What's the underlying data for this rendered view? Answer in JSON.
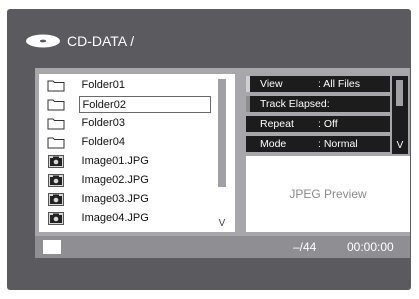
{
  "header": {
    "icon": "disc-icon",
    "path": "CD-DATA /"
  },
  "file_list": {
    "items": [
      {
        "label": "Folder01",
        "icon": "folder-icon",
        "selected": false
      },
      {
        "label": "Folder02",
        "icon": "folder-icon",
        "selected": true
      },
      {
        "label": "Folder03",
        "icon": "folder-icon",
        "selected": false
      },
      {
        "label": "Folder04",
        "icon": "folder-icon",
        "selected": false
      },
      {
        "label": "Image01.JPG",
        "icon": "camera-icon",
        "selected": false
      },
      {
        "label": "Image02.JPG",
        "icon": "camera-icon",
        "selected": false
      },
      {
        "label": "Image03.JPG",
        "icon": "camera-icon",
        "selected": false
      },
      {
        "label": "Image04.JPG",
        "icon": "camera-icon",
        "selected": false
      }
    ],
    "scroll_arrow": "V"
  },
  "info": {
    "rows": [
      {
        "key": "View",
        "value": ": All Files"
      },
      {
        "key": "Track Elapsed:",
        "value": ""
      },
      {
        "key": "Repeat",
        "value": ": Off"
      },
      {
        "key": "Mode",
        "value": ": Normal"
      }
    ],
    "scroll_arrow": "V"
  },
  "preview": {
    "label": "JPEG Preview"
  },
  "status": {
    "count": "–/44",
    "time": "00:00:00"
  },
  "colors": {
    "screen_bg": "#5a5a5f",
    "panel_bg": "#a6a6ab",
    "info_row_bg": "#1c1c1c",
    "status_bg": "#8e8e93"
  }
}
